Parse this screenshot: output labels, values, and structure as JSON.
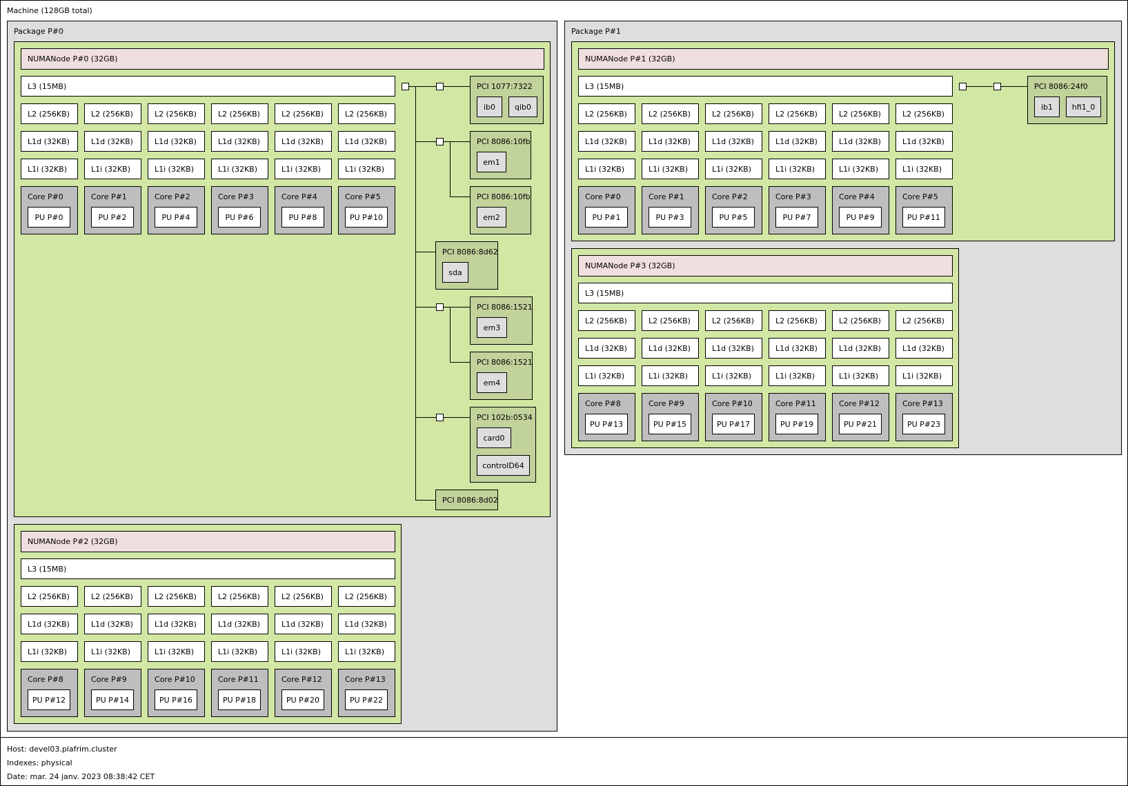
{
  "machine": {
    "title": "Machine (128GB total)"
  },
  "packages": [
    {
      "name": "Package P#0",
      "numa": [
        {
          "name": "NUMANode P#0 (32GB)",
          "l3": "L3 (15MB)",
          "l2": [
            "L2 (256KB)",
            "L2 (256KB)",
            "L2 (256KB)",
            "L2 (256KB)",
            "L2 (256KB)",
            "L2 (256KB)"
          ],
          "l1d": [
            "L1d (32KB)",
            "L1d (32KB)",
            "L1d (32KB)",
            "L1d (32KB)",
            "L1d (32KB)",
            "L1d (32KB)"
          ],
          "l1i": [
            "L1i (32KB)",
            "L1i (32KB)",
            "L1i (32KB)",
            "L1i (32KB)",
            "L1i (32KB)",
            "L1i (32KB)"
          ],
          "cores": [
            {
              "core": "Core P#0",
              "pu": "PU P#0"
            },
            {
              "core": "Core P#1",
              "pu": "PU P#2"
            },
            {
              "core": "Core P#2",
              "pu": "PU P#4"
            },
            {
              "core": "Core P#3",
              "pu": "PU P#6"
            },
            {
              "core": "Core P#4",
              "pu": "PU P#8"
            },
            {
              "core": "Core P#5",
              "pu": "PU P#10"
            }
          ],
          "pci": [
            {
              "name": "PCI 1077:7322",
              "devices": [
                "ib0",
                "qib0"
              ]
            },
            {
              "name": "PCI 8086:10fb",
              "devices": [
                "em1"
              ]
            },
            {
              "name": "PCI 8086:10fb",
              "devices": [
                "em2"
              ]
            },
            {
              "name": "PCI 8086:8d62",
              "devices": [
                "sda"
              ]
            },
            {
              "name": "PCI 8086:1521",
              "devices": [
                "em3"
              ]
            },
            {
              "name": "PCI 8086:1521",
              "devices": [
                "em4"
              ]
            },
            {
              "name": "PCI 102b:0534",
              "devices": [
                "card0",
                "controlD64"
              ]
            },
            {
              "name": "PCI 8086:8d02",
              "devices": []
            }
          ]
        },
        {
          "name": "NUMANode P#2 (32GB)",
          "l3": "L3 (15MB)",
          "l2": [
            "L2 (256KB)",
            "L2 (256KB)",
            "L2 (256KB)",
            "L2 (256KB)",
            "L2 (256KB)",
            "L2 (256KB)"
          ],
          "l1d": [
            "L1d (32KB)",
            "L1d (32KB)",
            "L1d (32KB)",
            "L1d (32KB)",
            "L1d (32KB)",
            "L1d (32KB)"
          ],
          "l1i": [
            "L1i (32KB)",
            "L1i (32KB)",
            "L1i (32KB)",
            "L1i (32KB)",
            "L1i (32KB)",
            "L1i (32KB)"
          ],
          "cores": [
            {
              "core": "Core P#8",
              "pu": "PU P#12"
            },
            {
              "core": "Core P#9",
              "pu": "PU P#14"
            },
            {
              "core": "Core P#10",
              "pu": "PU P#16"
            },
            {
              "core": "Core P#11",
              "pu": "PU P#18"
            },
            {
              "core": "Core P#12",
              "pu": "PU P#20"
            },
            {
              "core": "Core P#13",
              "pu": "PU P#22"
            }
          ],
          "pci": []
        }
      ]
    },
    {
      "name": "Package P#1",
      "numa": [
        {
          "name": "NUMANode P#1 (32GB)",
          "l3": "L3 (15MB)",
          "l2": [
            "L2 (256KB)",
            "L2 (256KB)",
            "L2 (256KB)",
            "L2 (256KB)",
            "L2 (256KB)",
            "L2 (256KB)"
          ],
          "l1d": [
            "L1d (32KB)",
            "L1d (32KB)",
            "L1d (32KB)",
            "L1d (32KB)",
            "L1d (32KB)",
            "L1d (32KB)"
          ],
          "l1i": [
            "L1i (32KB)",
            "L1i (32KB)",
            "L1i (32KB)",
            "L1i (32KB)",
            "L1i (32KB)",
            "L1i (32KB)"
          ],
          "cores": [
            {
              "core": "Core P#0",
              "pu": "PU P#1"
            },
            {
              "core": "Core P#1",
              "pu": "PU P#3"
            },
            {
              "core": "Core P#2",
              "pu": "PU P#5"
            },
            {
              "core": "Core P#3",
              "pu": "PU P#7"
            },
            {
              "core": "Core P#4",
              "pu": "PU P#9"
            },
            {
              "core": "Core P#5",
              "pu": "PU P#11"
            }
          ],
          "pci": [
            {
              "name": "PCI 8086:24f0",
              "devices": [
                "ib1",
                "hfi1_0"
              ]
            }
          ]
        },
        {
          "name": "NUMANode P#3 (32GB)",
          "l3": "L3 (15MB)",
          "l2": [
            "L2 (256KB)",
            "L2 (256KB)",
            "L2 (256KB)",
            "L2 (256KB)",
            "L2 (256KB)",
            "L2 (256KB)"
          ],
          "l1d": [
            "L1d (32KB)",
            "L1d (32KB)",
            "L1d (32KB)",
            "L1d (32KB)",
            "L1d (32KB)",
            "L1d (32KB)"
          ],
          "l1i": [
            "L1i (32KB)",
            "L1i (32KB)",
            "L1i (32KB)",
            "L1i (32KB)",
            "L1i (32KB)",
            "L1i (32KB)"
          ],
          "cores": [
            {
              "core": "Core P#8",
              "pu": "PU P#13"
            },
            {
              "core": "Core P#9",
              "pu": "PU P#15"
            },
            {
              "core": "Core P#10",
              "pu": "PU P#17"
            },
            {
              "core": "Core P#11",
              "pu": "PU P#19"
            },
            {
              "core": "Core P#12",
              "pu": "PU P#21"
            },
            {
              "core": "Core P#13",
              "pu": "PU P#23"
            }
          ],
          "pci": []
        }
      ]
    }
  ],
  "footer": {
    "host": "Host: devel03.plafrim.cluster",
    "indexes": "Indexes: physical",
    "date": "Date: mar. 24 janv. 2023 08:38:42 CET"
  },
  "colors": {
    "machine": "#ffffff",
    "package": "#dedede",
    "numa_group": "#d2e7a4",
    "numa_header": "#efdfde",
    "cache": "#ffffff",
    "core": "#bebebe",
    "pu": "#ffffff",
    "pci_device": "#c1d29b",
    "os_device": "#dedede"
  }
}
